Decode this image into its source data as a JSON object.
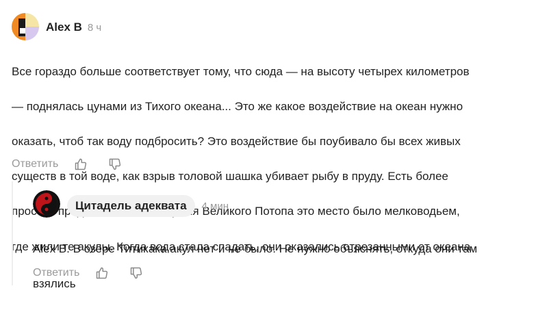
{
  "comment": {
    "author": "Alex B",
    "time": "8 ч",
    "lines": [
      "Все гораздо больше соответствует тому, что сюда — на высоту четырех километров",
      "— поднялась цунами из Тихого океана... Это же какое воздействие на океан нужно",
      "оказать, чтоб так воду подбросить? Это воздействие бы поубивало бы всех живых",
      "существ в той воде, как взрыв толовой шашка убивает рыбу в пруду. Есть более",
      "простое предположение: во время Великого Потопа это место было мелководьем,",
      "где жили те акулы. Когда вода стала спадать, они оказались отрезанными от океана."
    ],
    "reply_label": "Ответить",
    "like_icon": "thumbs-up-icon",
    "dislike_icon": "thumbs-down-icon"
  },
  "reply": {
    "author": "Цитадель адеквата",
    "time": "4 мин",
    "lines": [
      "Alex B. В озере Титикака акул нет и не было. Не нужно объяснять, откуда они там",
      "взялись"
    ],
    "reply_label": "Ответить",
    "like_icon": "thumbs-up-icon",
    "dislike_icon": "thumbs-down-icon"
  },
  "colors": {
    "text": "#222222",
    "muted": "#9a9a9a",
    "pill": "#f1f1f1",
    "avatar_orange": "#f08a24",
    "avatar_yellow": "#f5e6a6",
    "avatar_lilac": "#d7c8ef",
    "avatar_red": "#c0141b"
  }
}
